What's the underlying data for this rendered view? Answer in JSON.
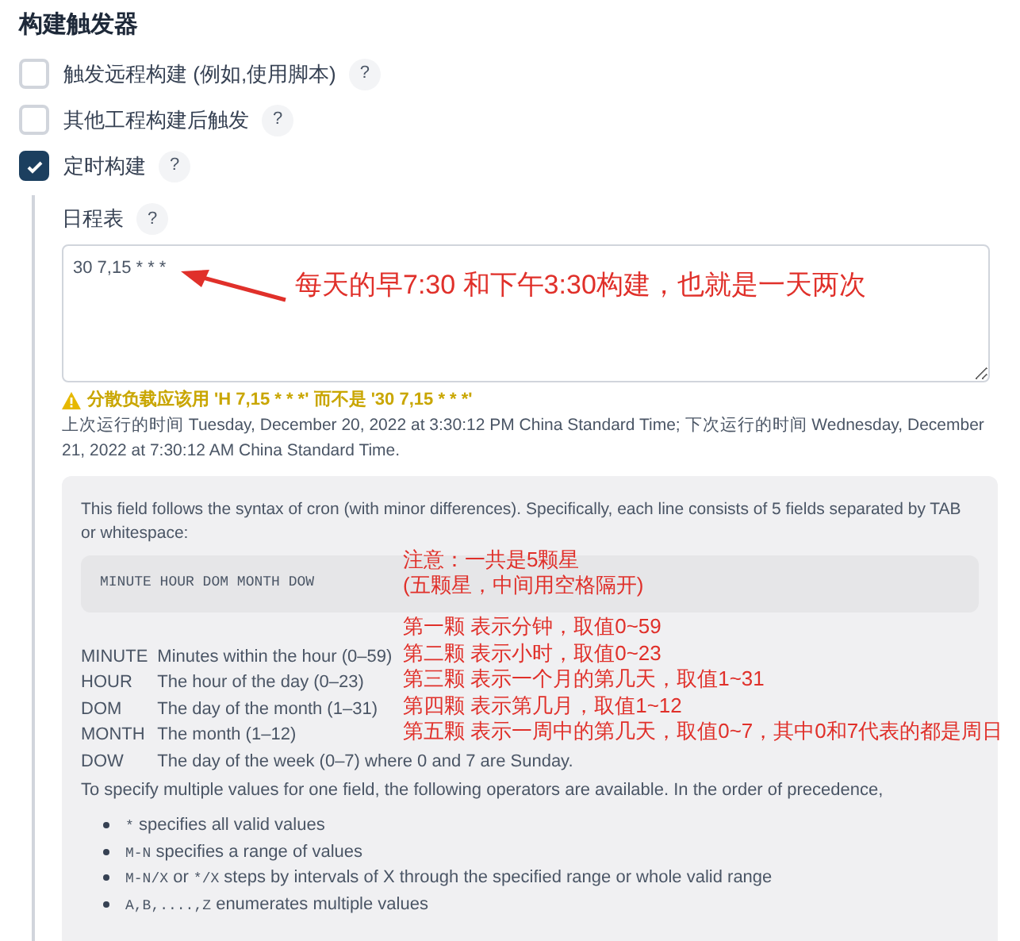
{
  "section_title": "构建触发器",
  "triggers": [
    {
      "label": "触发远程构建 (例如,使用脚本)",
      "help": "?",
      "checked": false
    },
    {
      "label": "其他工程构建后触发",
      "help": "?",
      "checked": false
    },
    {
      "label": "定时构建",
      "help": "?",
      "checked": true
    }
  ],
  "schedule": {
    "label": "日程表",
    "help": "?",
    "value": "30 7,15 * * *",
    "warning": "分散负载应该用 'H 7,15 * * *' 而不是 '30 7,15 * * *'",
    "info": "上次运行的时间 Tuesday, December 20, 2022 at 3:30:12 PM China Standard Time; 下次运行的时间 Wednesday, December 21, 2022 at 7:30:12 AM China Standard Time."
  },
  "help_panel": {
    "intro": "This field follows the syntax of cron (with minor differences). Specifically, each line consists of 5 fields separated by TAB or whitespace:",
    "syntax": "MINUTE HOUR DOM MONTH DOW",
    "fields": [
      {
        "name": "MINUTE",
        "description": "Minutes within the hour (0–59)"
      },
      {
        "name": "HOUR",
        "description": "The hour of the day (0–23)"
      },
      {
        "name": "DOM",
        "description": "The day of the month (1–31)"
      },
      {
        "name": "MONTH",
        "description": "The month (1–12)"
      },
      {
        "name": "DOW",
        "description": "The day of the week (0–7) where 0 and 7 are Sunday."
      }
    ],
    "operators_intro": "To specify multiple values for one field, the following operators are available. In the order of precedence,",
    "operators": [
      {
        "parts": [
          {
            "kind": "code",
            "text": "*"
          },
          {
            "kind": "text",
            "text": " specifies all valid values"
          }
        ]
      },
      {
        "parts": [
          {
            "kind": "code",
            "text": "M-N"
          },
          {
            "kind": "text",
            "text": " specifies a range of values"
          }
        ]
      },
      {
        "parts": [
          {
            "kind": "code",
            "text": "M-N/X"
          },
          {
            "kind": "text",
            "text": " or "
          },
          {
            "kind": "code",
            "text": "*/X"
          },
          {
            "kind": "text",
            "text": " steps by intervals of X through the specified range or whole valid range"
          }
        ]
      },
      {
        "parts": [
          {
            "kind": "code",
            "text": "A,B,....,Z"
          },
          {
            "kind": "text",
            "text": " enumerates multiple values"
          }
        ]
      }
    ]
  },
  "annotations": {
    "arrow_note": "每天的早7:30 和下午3:30构建，也就是一天两次",
    "syntax_notes": [
      "注意：一共是5颗星",
      "(五颗星，中间用空格隔开)"
    ],
    "field_notes": [
      "第一颗 表示分钟，取值0~59",
      "第二颗 表示小时，取值0~23",
      "第三颗 表示一个月的第几天，取值1~31",
      "第四颗 表示第几月，取值1~12",
      "第五颗 表示一周中的第几天，取值0~7，其中0和7代表的都是周日"
    ]
  }
}
